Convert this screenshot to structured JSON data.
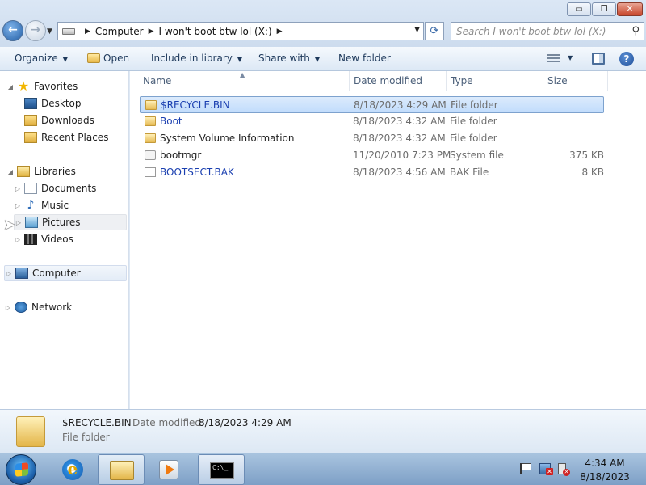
{
  "window": {
    "minimize_glyph": "▭",
    "maximize_glyph": "❐",
    "close_glyph": "✕"
  },
  "address": {
    "crumbs": [
      "Computer",
      "I won't boot btw lol (X:)"
    ],
    "refresh_glyph": "⟳"
  },
  "search": {
    "placeholder": "Search I won't boot btw lol (X:)"
  },
  "toolbar": {
    "organize": "Organize",
    "open": "Open",
    "include_in_library": "Include in library",
    "share_with": "Share with",
    "new_folder": "New folder",
    "help_glyph": "?"
  },
  "nav": {
    "favorites": "Favorites",
    "desktop": "Desktop",
    "downloads": "Downloads",
    "recent_places": "Recent Places",
    "libraries": "Libraries",
    "documents": "Documents",
    "music": "Music",
    "pictures": "Pictures",
    "videos": "Videos",
    "computer": "Computer",
    "network": "Network"
  },
  "columns": {
    "name": "Name",
    "date_modified": "Date modified",
    "type": "Type",
    "size": "Size"
  },
  "files": [
    {
      "name": "$RECYCLE.BIN",
      "date": "8/18/2023 4:29 AM",
      "type": "File folder",
      "size": "",
      "icon": "folder-icon",
      "selected": true,
      "compressed": true
    },
    {
      "name": "Boot",
      "date": "8/18/2023 4:32 AM",
      "type": "File folder",
      "size": "",
      "icon": "folder-icon",
      "selected": false,
      "compressed": true
    },
    {
      "name": "System Volume Information",
      "date": "8/18/2023 4:32 AM",
      "type": "File folder",
      "size": "",
      "icon": "folder-icon",
      "selected": false,
      "compressed": false
    },
    {
      "name": "bootmgr",
      "date": "11/20/2010 7:23 PM",
      "type": "System file",
      "size": "375 KB",
      "icon": "system-file-icon",
      "selected": false,
      "compressed": false
    },
    {
      "name": "BOOTSECT.BAK",
      "date": "8/18/2023 4:56 AM",
      "type": "BAK File",
      "size": "8 KB",
      "icon": "file-icon",
      "selected": false,
      "compressed": true
    }
  ],
  "details": {
    "name": "$RECYCLE.BIN",
    "date_label": "Date modified:",
    "date": "8/18/2023 4:29 AM",
    "type": "File folder"
  },
  "taskbar": {
    "cmd_prompt_text": "C:\\_",
    "time": "4:34 AM",
    "date": "8/18/2023"
  },
  "colors": {
    "selection": "#cce4fc",
    "compressed_text": "#1a3fb0",
    "accent": "#1e395b"
  }
}
